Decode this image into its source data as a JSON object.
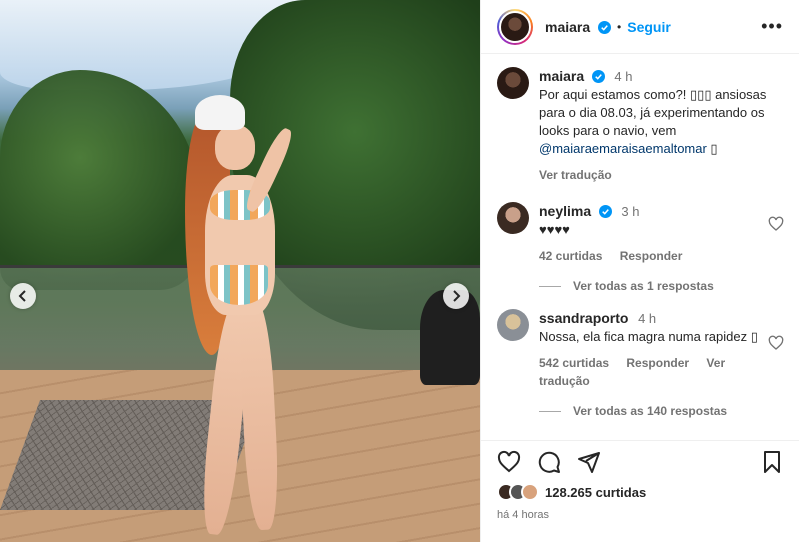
{
  "post": {
    "author": "maiara",
    "follow_label": "Seguir",
    "more_label": "•••",
    "dot": "•"
  },
  "caption": {
    "user": "maiara",
    "time": "4 h",
    "text": "Por aqui estamos como?! ▯▯▯ ansiosas para o dia 08.03, já experimentando os looks para o navio, vem ",
    "mention": "@maiaraemaraisaemaltomar",
    "tail": " ▯",
    "translate": "Ver tradução"
  },
  "comments": [
    {
      "user": "neylima",
      "verified": true,
      "time": "3 h",
      "text": "♥♥♥♥",
      "likes": "42 curtidas",
      "reply": "Responder",
      "translate": "",
      "view_replies": "Ver todas as 1 respostas"
    },
    {
      "user": "ssandraporto",
      "verified": false,
      "time": "4 h",
      "text": "Nossa, ela fica magra numa rapidez ▯",
      "likes": "542 curtidas",
      "reply": "Responder",
      "translate": "Ver tradução",
      "view_replies": "Ver todas as 140 respostas"
    }
  ],
  "footer": {
    "likes": "128.265 curtidas",
    "posted": "há 4 horas"
  },
  "colors": {
    "accent": "#0095f6",
    "verified": "#0095f6",
    "muted": "#737373"
  },
  "icons": [
    "chevron-left-icon",
    "chevron-right-icon",
    "heart-icon",
    "comment-icon",
    "share-icon",
    "bookmark-icon",
    "verified-icon"
  ]
}
